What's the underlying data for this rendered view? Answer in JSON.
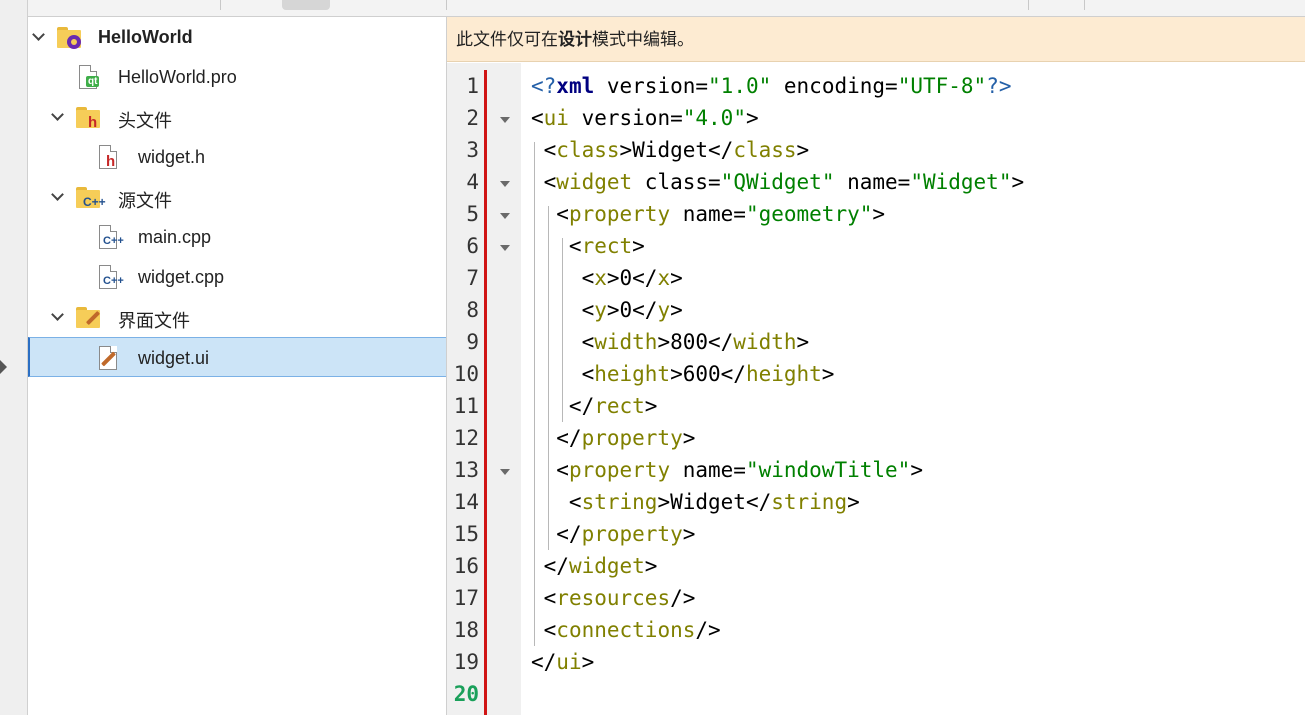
{
  "project_tree": {
    "project": {
      "label": "HelloWorld",
      "icon": "project-folder-gear-icon"
    },
    "items": [
      {
        "label": "HelloWorld.pro",
        "icon": "qt-project-file-icon"
      },
      {
        "label": "头文件",
        "icon": "header-folder-icon"
      },
      {
        "label": "widget.h",
        "icon": "header-file-icon"
      },
      {
        "label": "源文件",
        "icon": "source-folder-icon"
      },
      {
        "label": "main.cpp",
        "icon": "cpp-file-icon"
      },
      {
        "label": "widget.cpp",
        "icon": "cpp-file-icon"
      },
      {
        "label": "界面文件",
        "icon": "form-folder-icon"
      },
      {
        "label": "widget.ui",
        "icon": "form-file-icon",
        "selected": true
      }
    ]
  },
  "editor": {
    "banner": {
      "before": "此文件仅可在",
      "emphasis": "设计",
      "after": "模式中编辑。"
    },
    "current_line": 20,
    "line_numbers": [
      "1",
      "2",
      "3",
      "4",
      "5",
      "6",
      "7",
      "8",
      "9",
      "10",
      "11",
      "12",
      "13",
      "14",
      "15",
      "16",
      "17",
      "18",
      "19",
      "20"
    ],
    "fold_markers_on_lines": [
      2,
      4,
      5,
      6,
      13
    ],
    "lines": [
      [
        [
          "pi",
          "<?"
        ],
        [
          "kw",
          "xml"
        ],
        [
          "b",
          " version="
        ],
        [
          "str",
          "\"1.0\""
        ],
        [
          "b",
          " encoding="
        ],
        [
          "str",
          "\"UTF-8\""
        ],
        [
          "pi",
          "?>"
        ]
      ],
      [
        [
          "b",
          "<"
        ],
        [
          "tag",
          "ui"
        ],
        [
          "b",
          " version="
        ],
        [
          "str",
          "\"4.0\""
        ],
        [
          "b",
          ">"
        ]
      ],
      [
        [
          "b",
          " <"
        ],
        [
          "tag",
          "class"
        ],
        [
          "b",
          ">Widget</"
        ],
        [
          "tag",
          "class"
        ],
        [
          "b",
          ">"
        ]
      ],
      [
        [
          "b",
          " <"
        ],
        [
          "tag",
          "widget"
        ],
        [
          "b",
          " class="
        ],
        [
          "str",
          "\"QWidget\""
        ],
        [
          "b",
          " name="
        ],
        [
          "str",
          "\"Widget\""
        ],
        [
          "b",
          ">"
        ]
      ],
      [
        [
          "b",
          "  <"
        ],
        [
          "tag",
          "property"
        ],
        [
          "b",
          " name="
        ],
        [
          "str",
          "\"geometry\""
        ],
        [
          "b",
          ">"
        ]
      ],
      [
        [
          "b",
          "   <"
        ],
        [
          "tag",
          "rect"
        ],
        [
          "b",
          ">"
        ]
      ],
      [
        [
          "b",
          "    <"
        ],
        [
          "tag",
          "x"
        ],
        [
          "b",
          ">0</"
        ],
        [
          "tag",
          "x"
        ],
        [
          "b",
          ">"
        ]
      ],
      [
        [
          "b",
          "    <"
        ],
        [
          "tag",
          "y"
        ],
        [
          "b",
          ">0</"
        ],
        [
          "tag",
          "y"
        ],
        [
          "b",
          ">"
        ]
      ],
      [
        [
          "b",
          "    <"
        ],
        [
          "tag",
          "width"
        ],
        [
          "b",
          ">800</"
        ],
        [
          "tag",
          "width"
        ],
        [
          "b",
          ">"
        ]
      ],
      [
        [
          "b",
          "    <"
        ],
        [
          "tag",
          "height"
        ],
        [
          "b",
          ">600</"
        ],
        [
          "tag",
          "height"
        ],
        [
          "b",
          ">"
        ]
      ],
      [
        [
          "b",
          "   </"
        ],
        [
          "tag",
          "rect"
        ],
        [
          "b",
          ">"
        ]
      ],
      [
        [
          "b",
          "  </"
        ],
        [
          "tag",
          "property"
        ],
        [
          "b",
          ">"
        ]
      ],
      [
        [
          "b",
          "  <"
        ],
        [
          "tag",
          "property"
        ],
        [
          "b",
          " name="
        ],
        [
          "str",
          "\"windowTitle\""
        ],
        [
          "b",
          ">"
        ]
      ],
      [
        [
          "b",
          "   <"
        ],
        [
          "tag",
          "string"
        ],
        [
          "b",
          ">Widget</"
        ],
        [
          "tag",
          "string"
        ],
        [
          "b",
          ">"
        ]
      ],
      [
        [
          "b",
          "  </"
        ],
        [
          "tag",
          "property"
        ],
        [
          "b",
          ">"
        ]
      ],
      [
        [
          "b",
          " </"
        ],
        [
          "tag",
          "widget"
        ],
        [
          "b",
          ">"
        ]
      ],
      [
        [
          "b",
          " <"
        ],
        [
          "tag",
          "resources"
        ],
        [
          "b",
          "/>"
        ]
      ],
      [
        [
          "b",
          " <"
        ],
        [
          "tag",
          "connections"
        ],
        [
          "b",
          "/>"
        ]
      ],
      [
        [
          "b",
          "</"
        ],
        [
          "tag",
          "ui"
        ],
        [
          "b",
          ">"
        ]
      ],
      []
    ]
  }
}
